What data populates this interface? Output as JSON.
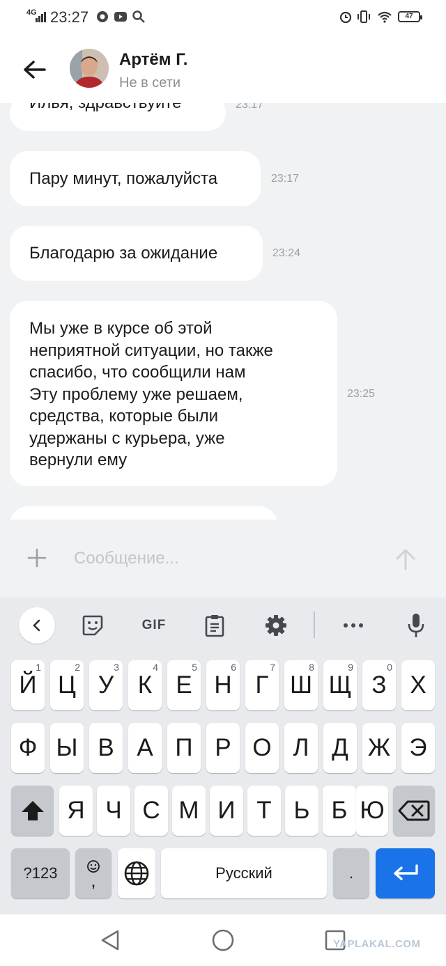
{
  "status_bar": {
    "network": "4G",
    "time": "23:27",
    "battery": "47"
  },
  "header": {
    "back_label": "back",
    "contact_name": "Артём Г.",
    "contact_status": "Не в сети"
  },
  "messages": [
    {
      "text": "Илья, здравствуйте",
      "time": "23:17"
    },
    {
      "text": "Пару минут, пожалуйста",
      "time": "23:17"
    },
    {
      "text": "Благодарю за ожидание",
      "time": "23:24"
    },
    {
      "lines": [
        "Мы уже в курсе об этой",
        "неприятной ситуации, но также",
        "спасибо, что сообщили нам",
        "Эту проблему уже решаем,",
        "средства, которые были",
        "удержаны с курьера, уже",
        "вернули ему"
      ],
      "time": "23:25"
    }
  ],
  "composer": {
    "placeholder": "Сообщение..."
  },
  "keyboard": {
    "toolbar": {
      "gif_label": "GIF"
    },
    "row1": [
      {
        "label": "Й",
        "hint": "1"
      },
      {
        "label": "Ц",
        "hint": "2"
      },
      {
        "label": "У",
        "hint": "3"
      },
      {
        "label": "К",
        "hint": "4"
      },
      {
        "label": "Е",
        "hint": "5"
      },
      {
        "label": "Н",
        "hint": "6"
      },
      {
        "label": "Г",
        "hint": "7"
      },
      {
        "label": "Ш",
        "hint": "8"
      },
      {
        "label": "Щ",
        "hint": "9"
      },
      {
        "label": "З",
        "hint": "0"
      },
      {
        "label": "Х",
        "hint": ""
      }
    ],
    "row2": [
      "Ф",
      "Ы",
      "В",
      "А",
      "П",
      "Р",
      "О",
      "Л",
      "Д",
      "Ж",
      "Э"
    ],
    "row3": [
      "Я",
      "Ч",
      "С",
      "М",
      "И",
      "Т",
      "Ь",
      "Б",
      "Ю"
    ],
    "symbols_label": "?123",
    "emoji_comma": ",",
    "space_label": "Русский",
    "period_label": "."
  },
  "watermark": "YAPLAKAL.COM",
  "colors": {
    "accent": "#1a73e8",
    "chat_background": "#f1f2f4",
    "bubble": "#ffffff",
    "keyboard_background": "#e8eaed"
  }
}
